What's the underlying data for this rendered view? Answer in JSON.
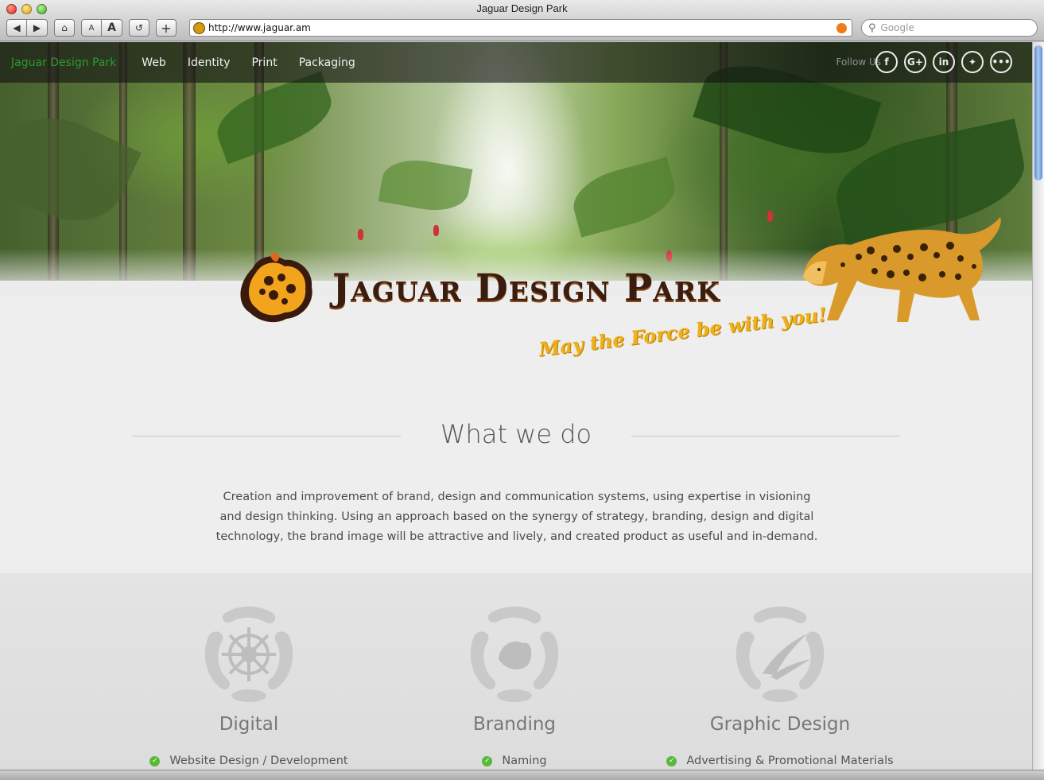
{
  "window": {
    "title": "Jaguar Design Park"
  },
  "toolbar": {
    "url": "http://www.jaguar.am",
    "search_placeholder": "Google",
    "text_small": "A",
    "text_large": "A",
    "add_label": "+"
  },
  "nav": {
    "brand": "Jaguar Design Park",
    "links": [
      "Web",
      "Identity",
      "Print",
      "Packaging"
    ],
    "follow_label": "Follow Us",
    "social": [
      "facebook-icon",
      "google-plus-icon",
      "linkedin-icon",
      "twitter-icon",
      "more-icon"
    ]
  },
  "hero": {
    "logo_text": "Jaguar Design Park",
    "tagline": "May the Force be with you!"
  },
  "about": {
    "heading": "What we do",
    "text": "Creation and improvement of brand, design and communication systems, using expertise in visioning and design thinking. Using an approach based on the synergy of strategy, branding, design and digital technology, the brand image will be attractive and lively, and created product as useful and in-demand."
  },
  "services": [
    {
      "title": "Digital",
      "first_item": "Website Design / Development"
    },
    {
      "title": "Branding",
      "first_item": "Naming"
    },
    {
      "title": "Graphic Design",
      "first_item": "Advertising & Promotional Materials"
    }
  ],
  "colors": {
    "brand_green": "#2f9b2f",
    "tagline_yellow": "#efb11a",
    "check_green": "#58b93a"
  }
}
